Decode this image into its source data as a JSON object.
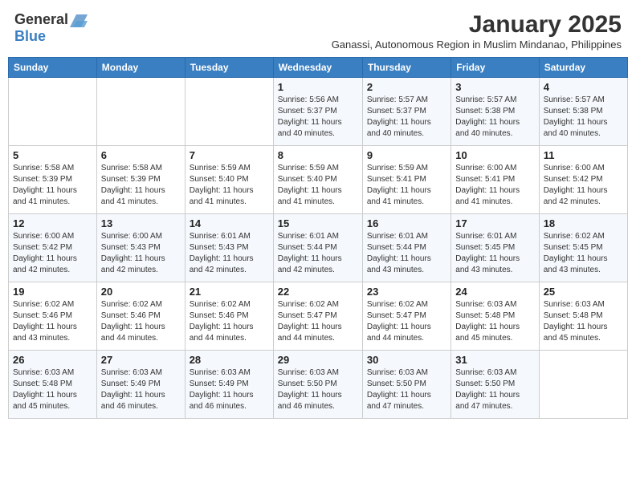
{
  "logo": {
    "general": "General",
    "blue": "Blue"
  },
  "title": "January 2025",
  "subtitle": "Ganassi, Autonomous Region in Muslim Mindanao, Philippines",
  "days_of_week": [
    "Sunday",
    "Monday",
    "Tuesday",
    "Wednesday",
    "Thursday",
    "Friday",
    "Saturday"
  ],
  "weeks": [
    [
      {
        "day": "",
        "detail": ""
      },
      {
        "day": "",
        "detail": ""
      },
      {
        "day": "",
        "detail": ""
      },
      {
        "day": "1",
        "detail": "Sunrise: 5:56 AM\nSunset: 5:37 PM\nDaylight: 11 hours\nand 40 minutes."
      },
      {
        "day": "2",
        "detail": "Sunrise: 5:57 AM\nSunset: 5:37 PM\nDaylight: 11 hours\nand 40 minutes."
      },
      {
        "day": "3",
        "detail": "Sunrise: 5:57 AM\nSunset: 5:38 PM\nDaylight: 11 hours\nand 40 minutes."
      },
      {
        "day": "4",
        "detail": "Sunrise: 5:57 AM\nSunset: 5:38 PM\nDaylight: 11 hours\nand 40 minutes."
      }
    ],
    [
      {
        "day": "5",
        "detail": "Sunrise: 5:58 AM\nSunset: 5:39 PM\nDaylight: 11 hours\nand 41 minutes."
      },
      {
        "day": "6",
        "detail": "Sunrise: 5:58 AM\nSunset: 5:39 PM\nDaylight: 11 hours\nand 41 minutes."
      },
      {
        "day": "7",
        "detail": "Sunrise: 5:59 AM\nSunset: 5:40 PM\nDaylight: 11 hours\nand 41 minutes."
      },
      {
        "day": "8",
        "detail": "Sunrise: 5:59 AM\nSunset: 5:40 PM\nDaylight: 11 hours\nand 41 minutes."
      },
      {
        "day": "9",
        "detail": "Sunrise: 5:59 AM\nSunset: 5:41 PM\nDaylight: 11 hours\nand 41 minutes."
      },
      {
        "day": "10",
        "detail": "Sunrise: 6:00 AM\nSunset: 5:41 PM\nDaylight: 11 hours\nand 41 minutes."
      },
      {
        "day": "11",
        "detail": "Sunrise: 6:00 AM\nSunset: 5:42 PM\nDaylight: 11 hours\nand 42 minutes."
      }
    ],
    [
      {
        "day": "12",
        "detail": "Sunrise: 6:00 AM\nSunset: 5:42 PM\nDaylight: 11 hours\nand 42 minutes."
      },
      {
        "day": "13",
        "detail": "Sunrise: 6:00 AM\nSunset: 5:43 PM\nDaylight: 11 hours\nand 42 minutes."
      },
      {
        "day": "14",
        "detail": "Sunrise: 6:01 AM\nSunset: 5:43 PM\nDaylight: 11 hours\nand 42 minutes."
      },
      {
        "day": "15",
        "detail": "Sunrise: 6:01 AM\nSunset: 5:44 PM\nDaylight: 11 hours\nand 42 minutes."
      },
      {
        "day": "16",
        "detail": "Sunrise: 6:01 AM\nSunset: 5:44 PM\nDaylight: 11 hours\nand 43 minutes."
      },
      {
        "day": "17",
        "detail": "Sunrise: 6:01 AM\nSunset: 5:45 PM\nDaylight: 11 hours\nand 43 minutes."
      },
      {
        "day": "18",
        "detail": "Sunrise: 6:02 AM\nSunset: 5:45 PM\nDaylight: 11 hours\nand 43 minutes."
      }
    ],
    [
      {
        "day": "19",
        "detail": "Sunrise: 6:02 AM\nSunset: 5:46 PM\nDaylight: 11 hours\nand 43 minutes."
      },
      {
        "day": "20",
        "detail": "Sunrise: 6:02 AM\nSunset: 5:46 PM\nDaylight: 11 hours\nand 44 minutes."
      },
      {
        "day": "21",
        "detail": "Sunrise: 6:02 AM\nSunset: 5:46 PM\nDaylight: 11 hours\nand 44 minutes."
      },
      {
        "day": "22",
        "detail": "Sunrise: 6:02 AM\nSunset: 5:47 PM\nDaylight: 11 hours\nand 44 minutes."
      },
      {
        "day": "23",
        "detail": "Sunrise: 6:02 AM\nSunset: 5:47 PM\nDaylight: 11 hours\nand 44 minutes."
      },
      {
        "day": "24",
        "detail": "Sunrise: 6:03 AM\nSunset: 5:48 PM\nDaylight: 11 hours\nand 45 minutes."
      },
      {
        "day": "25",
        "detail": "Sunrise: 6:03 AM\nSunset: 5:48 PM\nDaylight: 11 hours\nand 45 minutes."
      }
    ],
    [
      {
        "day": "26",
        "detail": "Sunrise: 6:03 AM\nSunset: 5:48 PM\nDaylight: 11 hours\nand 45 minutes."
      },
      {
        "day": "27",
        "detail": "Sunrise: 6:03 AM\nSunset: 5:49 PM\nDaylight: 11 hours\nand 46 minutes."
      },
      {
        "day": "28",
        "detail": "Sunrise: 6:03 AM\nSunset: 5:49 PM\nDaylight: 11 hours\nand 46 minutes."
      },
      {
        "day": "29",
        "detail": "Sunrise: 6:03 AM\nSunset: 5:50 PM\nDaylight: 11 hours\nand 46 minutes."
      },
      {
        "day": "30",
        "detail": "Sunrise: 6:03 AM\nSunset: 5:50 PM\nDaylight: 11 hours\nand 47 minutes."
      },
      {
        "day": "31",
        "detail": "Sunrise: 6:03 AM\nSunset: 5:50 PM\nDaylight: 11 hours\nand 47 minutes."
      },
      {
        "day": "",
        "detail": ""
      }
    ]
  ]
}
